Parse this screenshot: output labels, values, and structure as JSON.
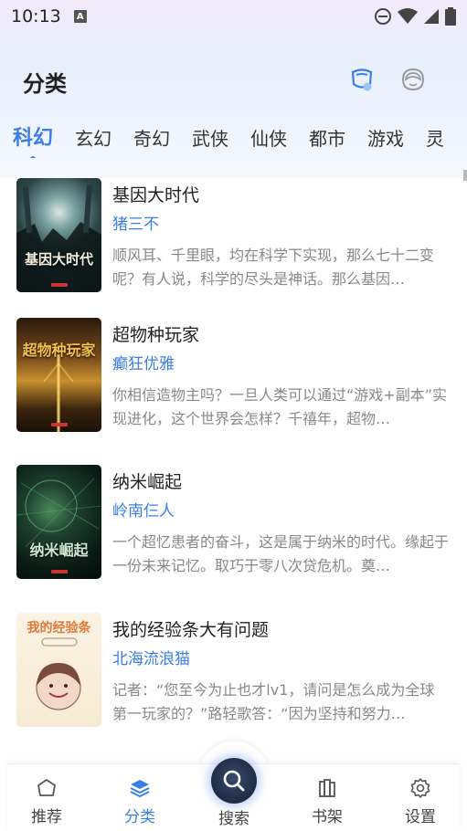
{
  "status_bar": {
    "time": "10:13",
    "notif_letter": "A"
  },
  "header": {
    "title": "分类"
  },
  "tabs": [
    "科幻",
    "玄幻",
    "奇幻",
    "武侠",
    "仙侠",
    "都市",
    "游戏",
    "灵"
  ],
  "active_tab_index": 0,
  "books": [
    {
      "title": "基因大时代",
      "author": "猪三不",
      "desc": "顺风耳、千里眼，均在科学下实现，那么七十二变呢？有人说，科学的尽头是神话。那么基因…",
      "cover_text": "基因大时代",
      "cover_colors": [
        "#1c2e30",
        "#46646a",
        "#0e1a1c"
      ]
    },
    {
      "title": "超物种玩家",
      "author": "癫狂优雅",
      "desc": "你相信造物主吗？一旦人类可以通过“游戏+副本”实现进化，这个世界会怎样？千禧年，超物…",
      "cover_text": "超物种玩家",
      "cover_colors": [
        "#3a2410",
        "#a06a24",
        "#1e140a"
      ]
    },
    {
      "title": "纳米崛起",
      "author": "岭南仨人",
      "desc": "一个超忆患者的奋斗，这是属于纳米的时代。缘起于一份未来记忆。取巧于零八次贷危机。奠…",
      "cover_text": "纳米崛起",
      "cover_colors": [
        "#0a1a14",
        "#2e5a3a",
        "#06100c"
      ]
    },
    {
      "title": "我的经验条大有问题",
      "author": "北海流浪猫",
      "desc": "记者：“您至今为止也才lv1，请问是怎么成为全球第一玩家的？”路轻歌答：“因为坚持和努力…",
      "cover_text": "我的经验条",
      "cover_colors": [
        "#fbf3e4",
        "#f4e2c6",
        "#fbf3e4"
      ]
    }
  ],
  "bottom_nav": {
    "items": [
      "推荐",
      "分类",
      "搜索",
      "书架",
      "设置"
    ],
    "active_index": 1
  },
  "colors": {
    "accent": "#3a7ee6",
    "author": "#3a7ee6",
    "desc": "#888888"
  }
}
